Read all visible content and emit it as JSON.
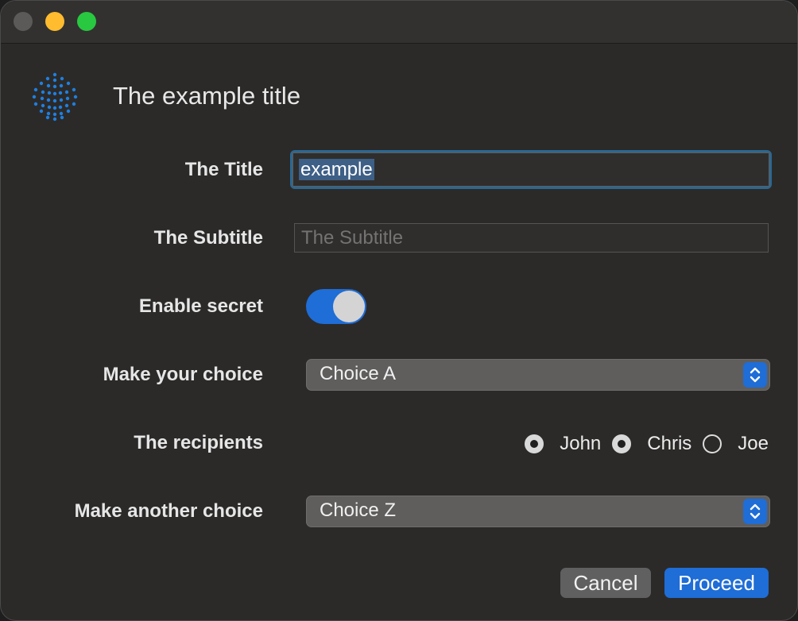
{
  "window": {
    "traffic_lights": [
      "close",
      "minimize",
      "maximize"
    ]
  },
  "header": {
    "title": "The example title",
    "logo_icon": "dotted-sphere-icon",
    "logo_color": "#1f7fe0"
  },
  "form": {
    "title_label": "The Title",
    "title_value": "example",
    "subtitle_label": "The Subtitle",
    "subtitle_placeholder": "The Subtitle",
    "secret_label": "Enable secret",
    "secret_enabled": true,
    "choice_label": "Make your choice",
    "choice_value": "Choice A",
    "recipients_label": "The recipients",
    "recipients": [
      {
        "label": "John",
        "selected": true
      },
      {
        "label": "Chris",
        "selected": true
      },
      {
        "label": "Joe",
        "selected": false
      }
    ],
    "another_choice_label": "Make another choice",
    "another_choice_value": "Choice Z"
  },
  "buttons": {
    "cancel": "Cancel",
    "proceed": "Proceed"
  },
  "colors": {
    "accent": "#1f6dd6",
    "background": "#2b2a29"
  }
}
